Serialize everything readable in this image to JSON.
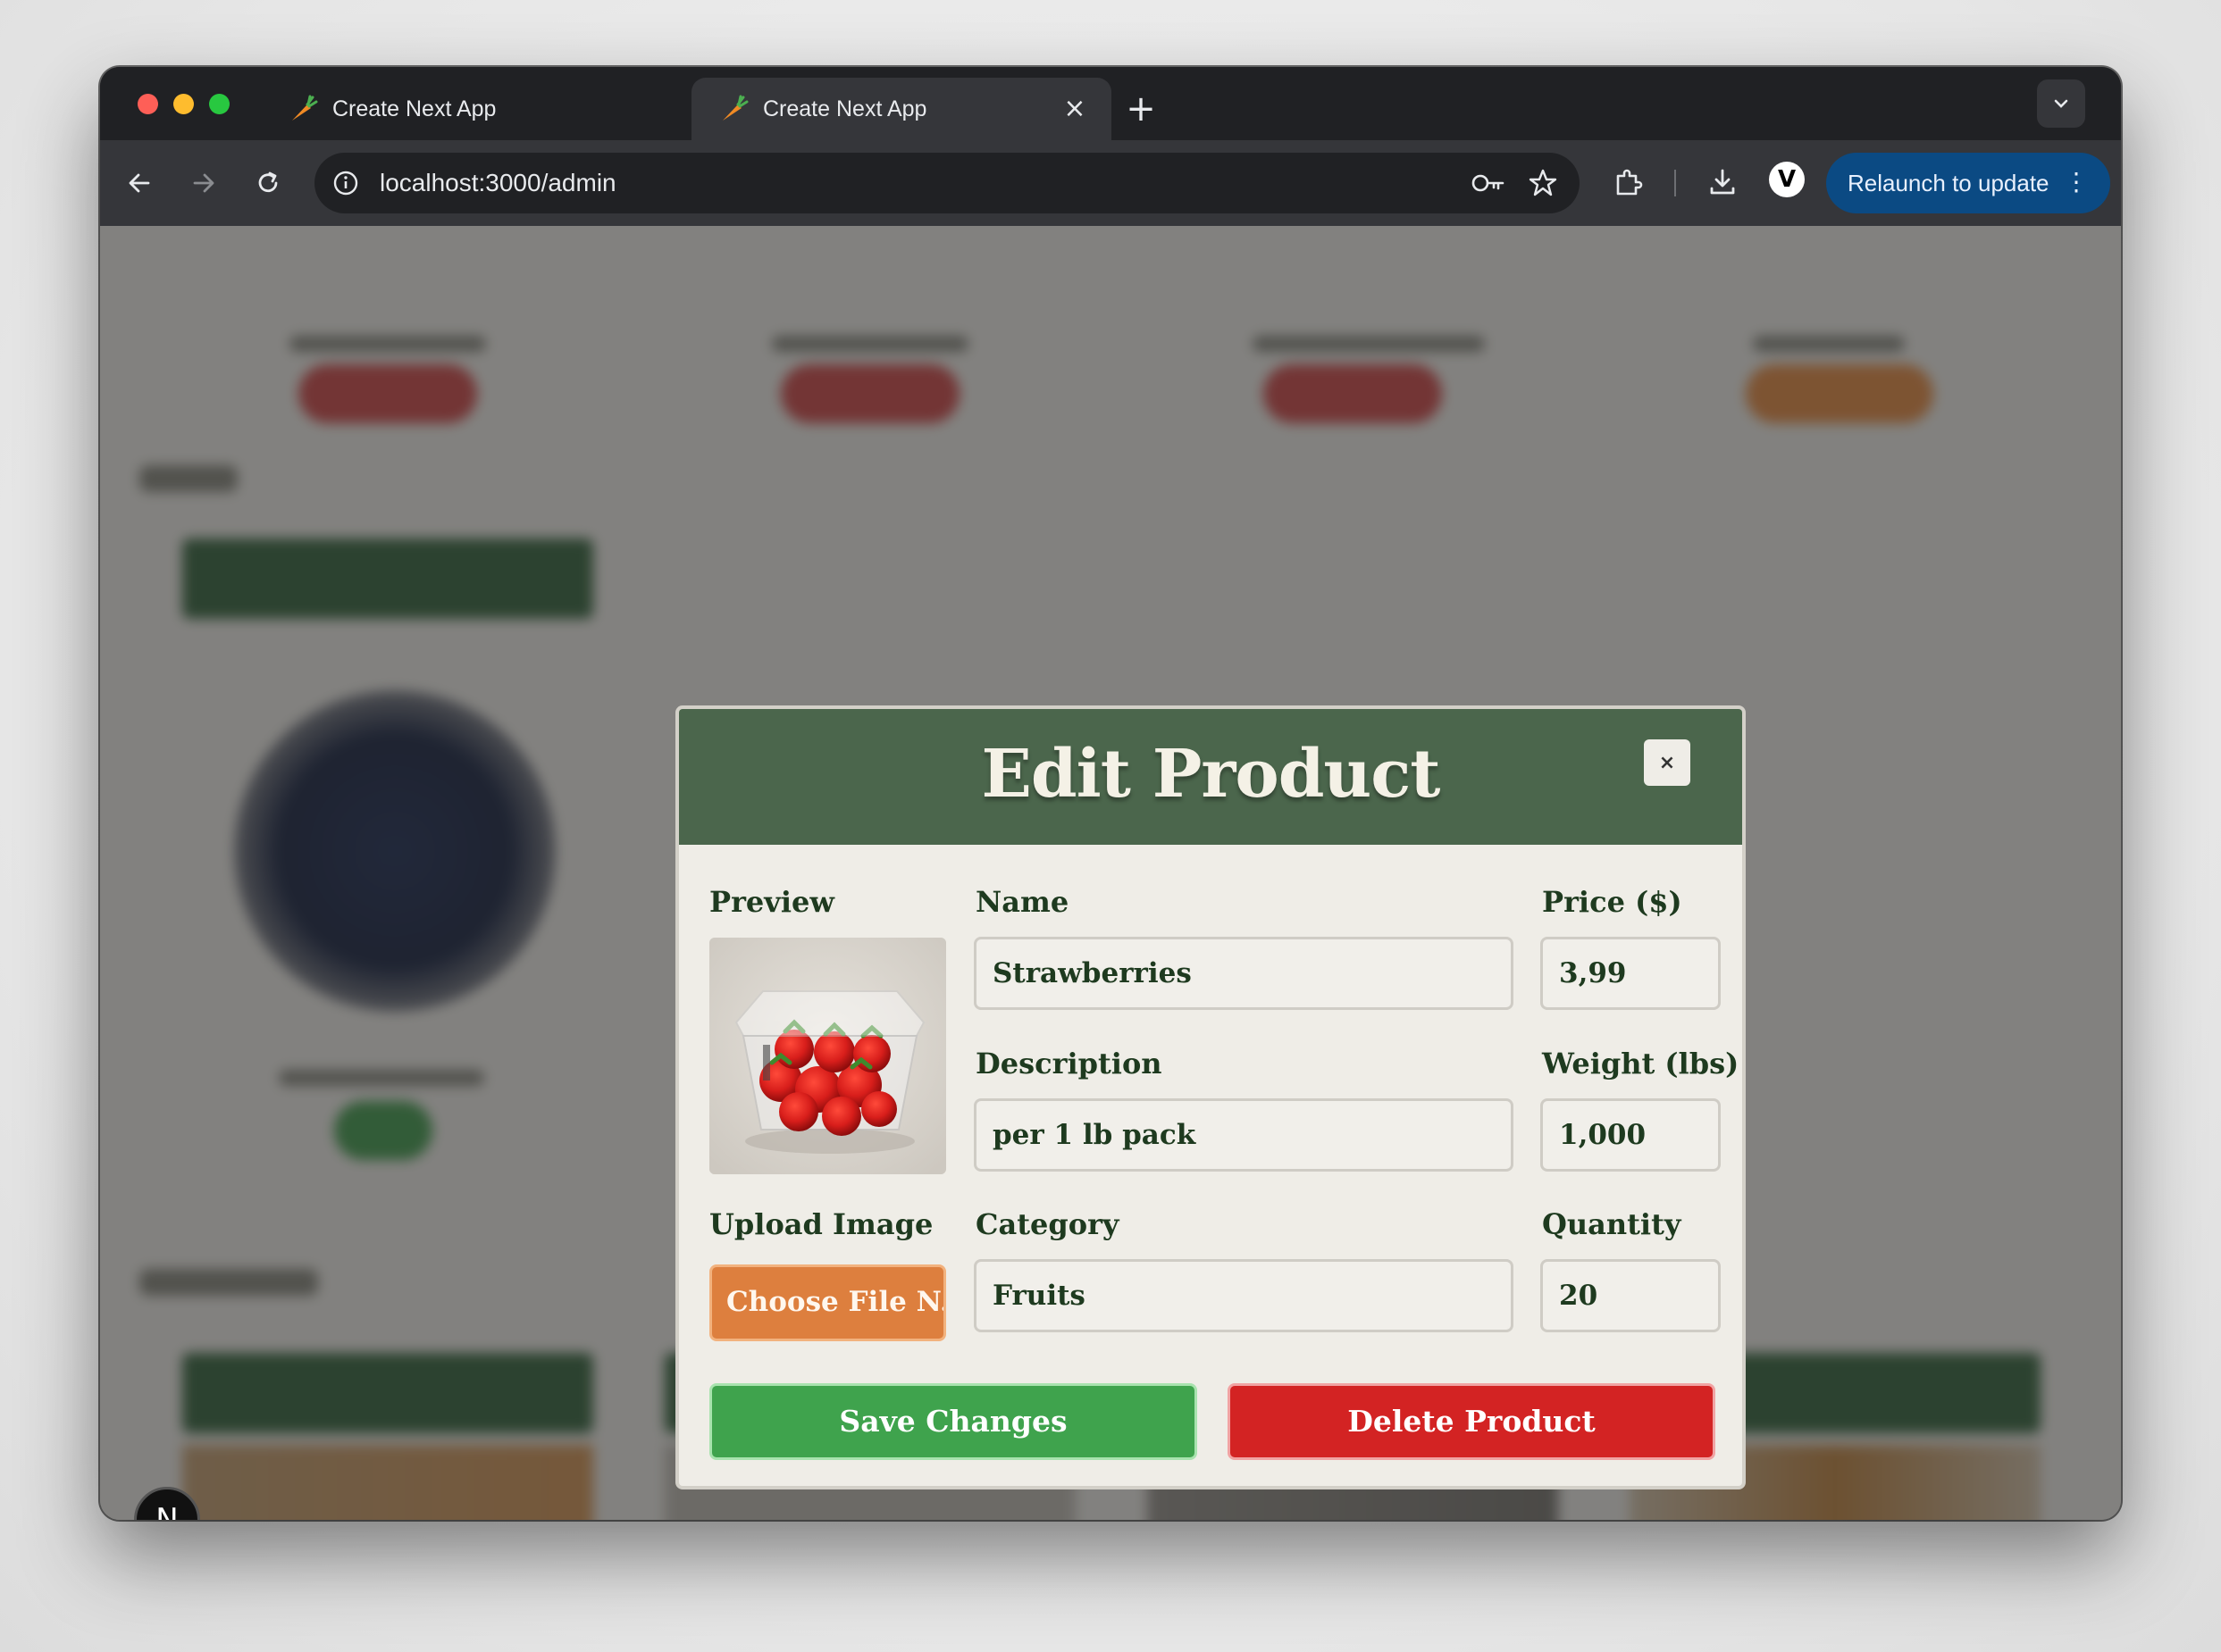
{
  "browser": {
    "tabs": [
      {
        "title": "Create Next App",
        "active": false
      },
      {
        "title": "Create Next App",
        "active": true
      }
    ],
    "url": "localhost:3000/admin",
    "relaunch_label": "Relaunch to update",
    "profile_initial": "V",
    "icons": [
      "back-icon",
      "forward-icon",
      "reload-icon",
      "site-info-icon",
      "password-key-icon",
      "bookmark-star-icon",
      "extensions-icon",
      "download-icon",
      "tab-search-chevron-icon",
      "carrot-favicon"
    ]
  },
  "modal": {
    "title": "Edit Product",
    "close_label": "×",
    "labels": {
      "preview": "Preview",
      "name": "Name",
      "price": "Price ($)",
      "description": "Description",
      "weight": "Weight (lbs)",
      "upload": "Upload Image",
      "category": "Category",
      "quantity": "Quantity"
    },
    "values": {
      "name": "Strawberries",
      "price": "3,99",
      "description": "per 1 lb pack",
      "weight": "1,000",
      "category": "Fruits",
      "quantity": "20"
    },
    "upload_button": "Choose File N...",
    "save_button": "Save Changes",
    "delete_button": "Delete Product",
    "colors": {
      "header": "#4b664c",
      "save": "#3fa34d",
      "delete": "#d32323",
      "upload": "#dd7f3e",
      "text": "#1e3a1f"
    }
  },
  "nextjs_badge": "N"
}
